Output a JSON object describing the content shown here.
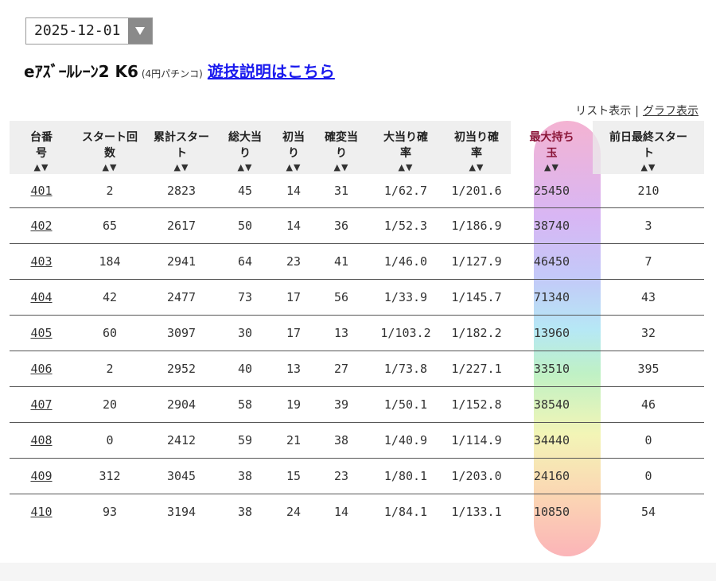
{
  "date_select": {
    "value": "2025-12-01",
    "arrow_icon": "triangle-down-icon"
  },
  "machine": {
    "name": "eｱｽﾞｰﾙﾚｰﾝ2 K6",
    "sub": "(4円パチンコ)",
    "link": "遊技説明はこちら"
  },
  "view_toggle": {
    "list": "リスト表示",
    "separator": "|",
    "graph": "グラフ表示"
  },
  "table": {
    "headers": [
      [
        "台番",
        "号"
      ],
      [
        "スタート回",
        "数"
      ],
      [
        "累計スター",
        "ト"
      ],
      [
        "総大当",
        "り"
      ],
      [
        "初当",
        "り"
      ],
      [
        "確変当",
        "り"
      ],
      [
        "大当り確",
        "率"
      ],
      [
        "初当り確",
        "率"
      ],
      [
        "最大持ち",
        "玉"
      ],
      [
        "前日最終スター",
        "ト"
      ]
    ],
    "sort_label": "▲▼",
    "rows": [
      [
        "401",
        "2",
        "2823",
        "45",
        "14",
        "31",
        "1/62.7",
        "1/201.6",
        "25450",
        "210"
      ],
      [
        "402",
        "65",
        "2617",
        "50",
        "14",
        "36",
        "1/52.3",
        "1/186.9",
        "38740",
        "3"
      ],
      [
        "403",
        "184",
        "2941",
        "64",
        "23",
        "41",
        "1/46.0",
        "1/127.9",
        "46450",
        "7"
      ],
      [
        "404",
        "42",
        "2477",
        "73",
        "17",
        "56",
        "1/33.9",
        "1/145.7",
        "71340",
        "43"
      ],
      [
        "405",
        "60",
        "3097",
        "30",
        "17",
        "13",
        "1/103.2",
        "1/182.2",
        "13960",
        "32"
      ],
      [
        "406",
        "2",
        "2952",
        "40",
        "13",
        "27",
        "1/73.8",
        "1/227.1",
        "33510",
        "395"
      ],
      [
        "407",
        "20",
        "2904",
        "58",
        "19",
        "39",
        "1/50.1",
        "1/152.8",
        "38540",
        "46"
      ],
      [
        "408",
        "0",
        "2412",
        "59",
        "21",
        "38",
        "1/40.9",
        "1/114.9",
        "34440",
        "0"
      ],
      [
        "409",
        "312",
        "3045",
        "38",
        "15",
        "23",
        "1/80.1",
        "1/203.0",
        "24160",
        "0"
      ],
      [
        "410",
        "93",
        "3194",
        "38",
        "24",
        "14",
        "1/84.1",
        "1/133.1",
        "10850",
        "54"
      ]
    ]
  },
  "colors": {
    "link": "#1a1aee",
    "header_bg": "#eaeaea",
    "highlight_top": "#f4b3d2",
    "highlight_bottom": "#fbb4b8"
  }
}
